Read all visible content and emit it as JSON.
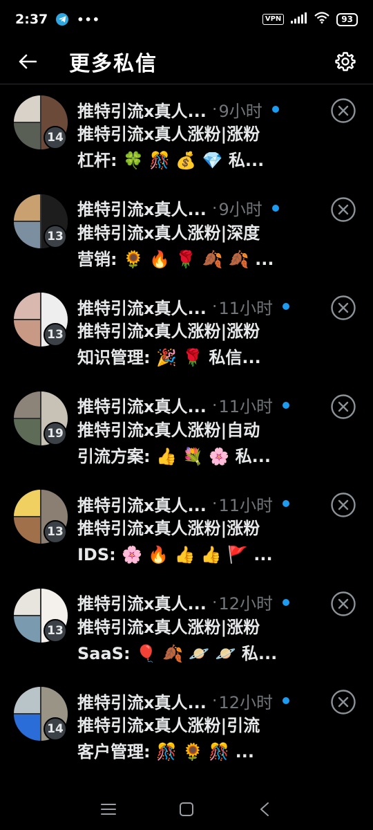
{
  "status_bar": {
    "time": "2:37",
    "notification_icons": [
      "telegram-icon",
      "more-dots-icon"
    ],
    "vpn": "VPN",
    "battery": "93"
  },
  "header": {
    "title": "更多私信"
  },
  "conversations": [
    {
      "sender": "推特引流x真人...",
      "separator": "·",
      "time": "9小时",
      "count": "14",
      "line1": "推特引流x真人涨粉|涨粉",
      "line2": "杠杆: 🍀 🎊 💰 💎 私...",
      "unread": true,
      "avatar_colors": [
        "#d8d2c9",
        "#6b4a3a",
        "#5a5f55"
      ]
    },
    {
      "sender": "推特引流x真人...",
      "separator": "·",
      "time": "9小时",
      "count": "13",
      "line1": "推特引流x真人涨粉|深度",
      "line2": "营销: 🌻 🔥 🌹 🍂 🍂 ...",
      "unread": true,
      "avatar_colors": [
        "#c9a070",
        "#1d1d1d",
        "#7b8fa0"
      ]
    },
    {
      "sender": "推特引流x真人...",
      "separator": "·",
      "time": "11小时",
      "count": "13",
      "line1": "推特引流x真人涨粉|涨粉",
      "line2": "知识管理: 🎉 🌹 私信...",
      "unread": true,
      "avatar_colors": [
        "#d9b8b0",
        "#eeeeee",
        "#c89a86"
      ]
    },
    {
      "sender": "推特引流x真人...",
      "separator": "·",
      "time": "11小时",
      "count": "19",
      "line1": "推特引流x真人涨粉|自动",
      "line2": "引流方案: 👍 💐 🌸 私...",
      "unread": true,
      "avatar_colors": [
        "#8c8478",
        "#c7c2b5",
        "#5d6b57"
      ]
    },
    {
      "sender": "推特引流x真人...",
      "separator": "·",
      "time": "11小时",
      "count": "13",
      "line1": "推特引流x真人涨粉|涨粉",
      "line2": "IDS: 🌸 🔥 👍 👍 🚩 ...",
      "unread": true,
      "avatar_colors": [
        "#f0d060",
        "#8a7f72",
        "#a0704a"
      ]
    },
    {
      "sender": "推特引流x真人...",
      "separator": "·",
      "time": "12小时",
      "count": "13",
      "line1": "推特引流x真人涨粉|涨粉",
      "line2": "SaaS: 🎈 🍂 🪐 🪐 私...",
      "unread": true,
      "avatar_colors": [
        "#e8e4de",
        "#f4f0ec",
        "#7a9ab0"
      ]
    },
    {
      "sender": "推特引流x真人...",
      "separator": "·",
      "time": "12小时",
      "count": "14",
      "line1": "推特引流x真人涨粉|引流",
      "line2": "客户管理: 🎊 🌻 🎊 ...",
      "unread": true,
      "avatar_colors": [
        "#b8c4c8",
        "#9a9486",
        "#2a6cd8"
      ]
    }
  ],
  "colors": {
    "accent": "#1d9bf0",
    "muted_text": "#71767b",
    "primary_text": "#e7e9ea",
    "background": "#000000"
  },
  "nav_bar": [
    "menu-icon",
    "home-square-icon",
    "back-chevron-icon"
  ]
}
